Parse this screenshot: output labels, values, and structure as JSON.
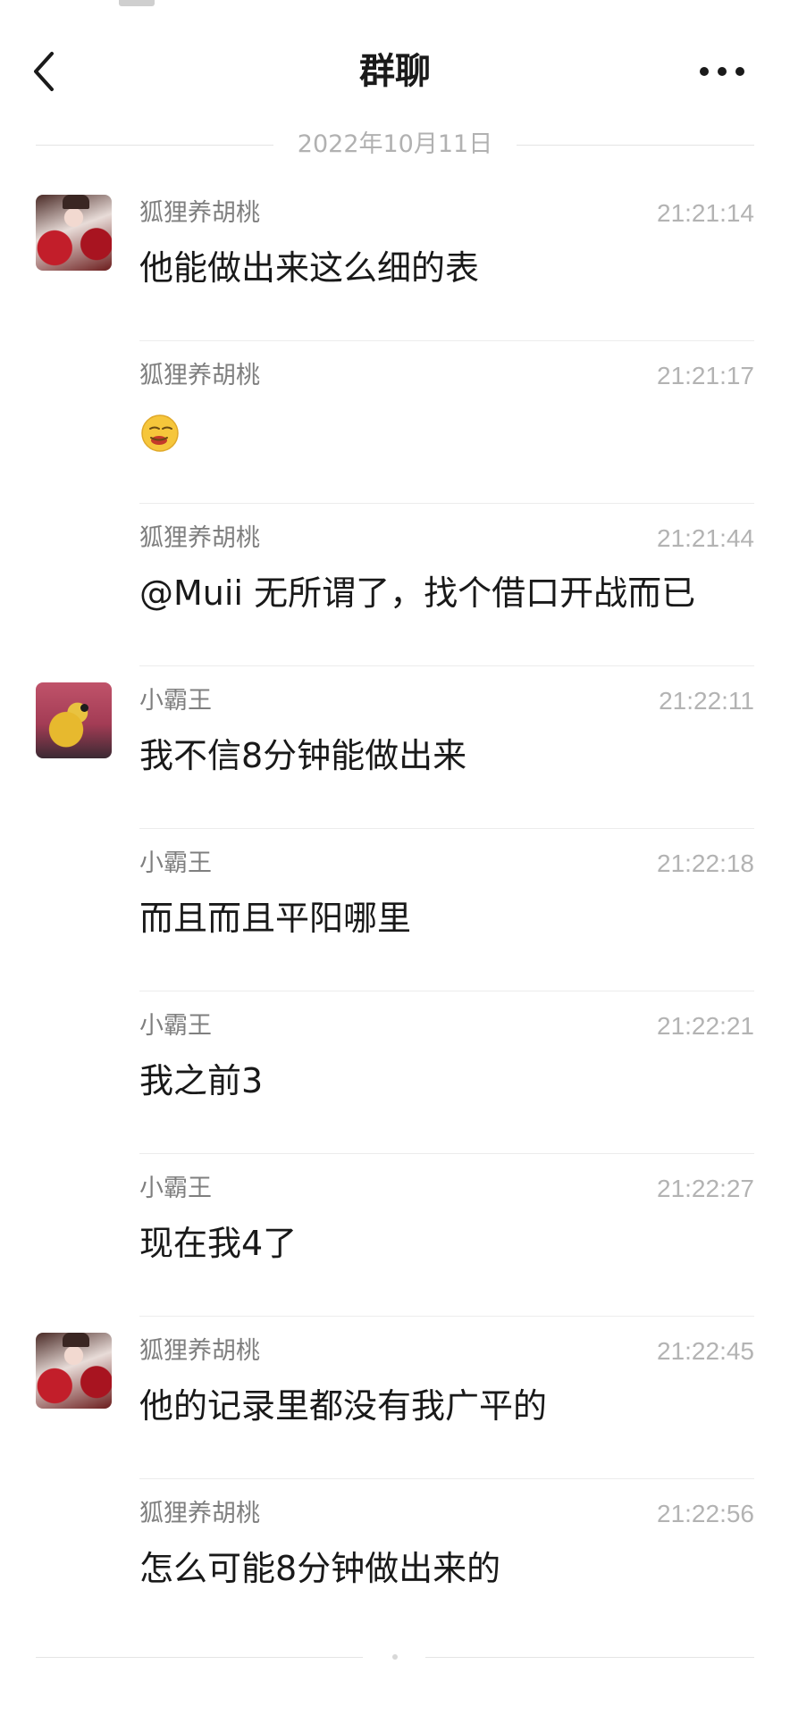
{
  "header": {
    "title": "群聊"
  },
  "date_separator": "2022年10月11日",
  "messages": [
    {
      "sender": "狐狸养胡桃",
      "time": "21:21:14",
      "text": "他能做出来这么细的表",
      "avatar": "hutao",
      "show_avatar": true
    },
    {
      "sender": "狐狸养胡桃",
      "time": "21:21:17",
      "text": "",
      "emoji": "smirk-face-icon",
      "show_avatar": false
    },
    {
      "sender": "狐狸养胡桃",
      "time": "21:21:44",
      "text": "@Muii 无所谓了，找个借口开战而已",
      "show_avatar": false
    },
    {
      "sender": "小霸王",
      "time": "21:22:11",
      "text": "我不信8分钟能做出来",
      "avatar": "frog",
      "show_avatar": true
    },
    {
      "sender": "小霸王",
      "time": "21:22:18",
      "text": "而且而且平阳哪里",
      "show_avatar": false
    },
    {
      "sender": "小霸王",
      "time": "21:22:21",
      "text": "我之前3",
      "show_avatar": false
    },
    {
      "sender": "小霸王",
      "time": "21:22:27",
      "text": "现在我4了",
      "show_avatar": false
    },
    {
      "sender": "狐狸养胡桃",
      "time": "21:22:45",
      "text": "他的记录里都没有我广平的",
      "avatar": "hutao",
      "show_avatar": true
    },
    {
      "sender": "狐狸养胡桃",
      "time": "21:22:56",
      "text": "怎么可能8分钟做出来的",
      "show_avatar": false
    }
  ],
  "icons": {
    "back": "chevron-left-icon",
    "more": "more-dots-icon"
  }
}
